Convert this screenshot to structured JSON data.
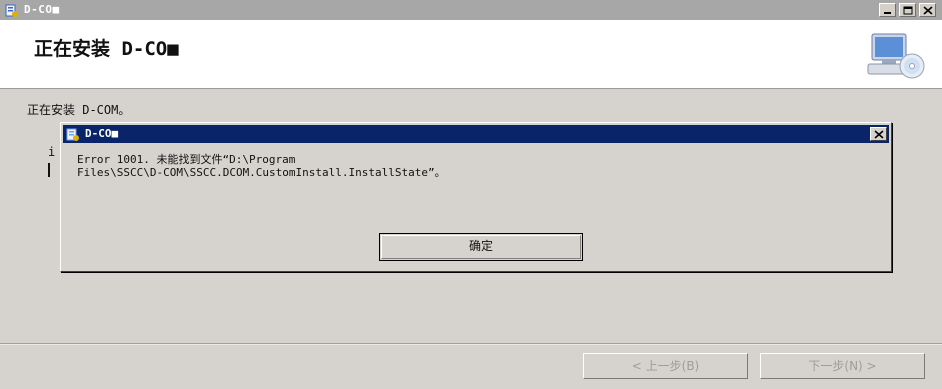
{
  "window": {
    "title": "D-CO■",
    "controls": [
      "minimize-icon",
      "maximize-icon",
      "close-icon"
    ]
  },
  "banner": {
    "title": "正在安装 D-CO■",
    "graphic": "computer-cd-icon"
  },
  "content": {
    "status": "正在安装 D-COM。",
    "behind_fragment": "i"
  },
  "dialog": {
    "title": "D-CO■",
    "message": "Error 1001. 未能找到文件“D:\\Program\nFiles\\SSCC\\D-COM\\SSCC.DCOM.CustomInstall.InstallState”。",
    "ok_label": "确定",
    "title_bar_color": "#0a246a"
  },
  "footer": {
    "back_label": "< 上一步(B)",
    "next_label": "下一步(N) >",
    "disabled_text_color": "#9d9d9d"
  }
}
